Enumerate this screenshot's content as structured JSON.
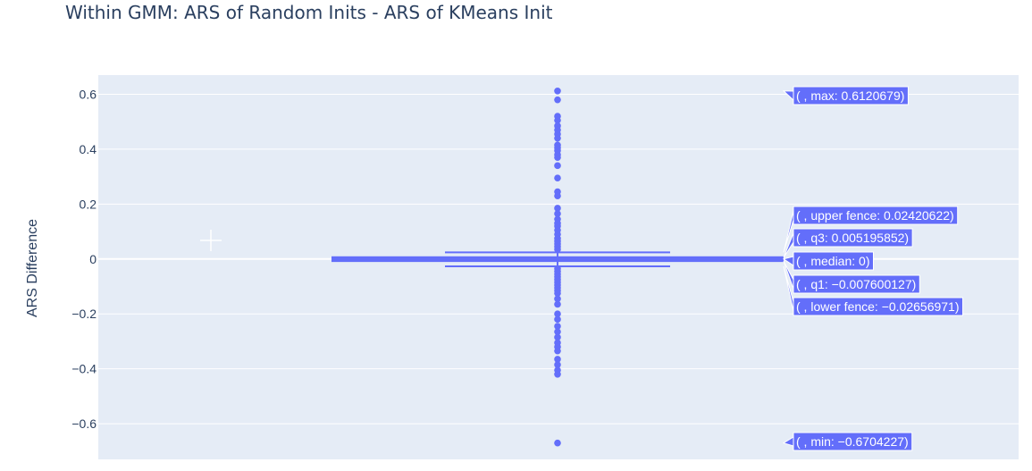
{
  "chart_data": {
    "type": "box",
    "title": "Within GMM: ARS of Random Inits - ARS of KMeans Init",
    "xlabel": "",
    "ylabel": "ARS Difference",
    "ylim": [
      -0.73,
      0.67
    ],
    "yticks": [
      {
        "value": 0.6,
        "label": "0.6"
      },
      {
        "value": 0.4,
        "label": "0.4"
      },
      {
        "value": 0.2,
        "label": "0.2"
      },
      {
        "value": 0,
        "label": "0"
      },
      {
        "value": -0.2,
        "label": "−0.2"
      },
      {
        "value": -0.4,
        "label": "−0.4"
      },
      {
        "value": -0.6,
        "label": "−0.6"
      }
    ],
    "grid": true,
    "colors": {
      "box": "#636efa",
      "background": "#e5ecf6",
      "grid": "#ffffff",
      "text": "#2a3f5f"
    },
    "stats": {
      "max": 0.6120679,
      "upper_fence": 0.02420622,
      "q3": 0.005195852,
      "median": 0,
      "q1": -0.007600127,
      "lower_fence": -0.02656971,
      "min": -0.6704227
    },
    "hover_labels": [
      {
        "key": "max",
        "text": "( , max: 0.6120679)"
      },
      {
        "key": "upper_fence",
        "text": "( , upper fence: 0.02420622)"
      },
      {
        "key": "q3",
        "text": "( , q3: 0.005195852)"
      },
      {
        "key": "median",
        "text": "( , median: 0)"
      },
      {
        "key": "q1",
        "text": "( , q1: −0.007600127)"
      },
      {
        "key": "lower_fence",
        "text": "( , lower fence: −0.02656971)"
      },
      {
        "key": "min",
        "text": "( , min: −0.6704227)"
      }
    ],
    "outliers": [
      0.6120679,
      0.58,
      0.52,
      0.505,
      0.485,
      0.47,
      0.455,
      0.44,
      0.415,
      0.405,
      0.395,
      0.38,
      0.37,
      0.34,
      0.295,
      0.245,
      0.23,
      0.185,
      0.165,
      0.145,
      0.13,
      0.12,
      0.105,
      0.09,
      0.075,
      0.065,
      0.055,
      0.045,
      0.035,
      -0.035,
      -0.045,
      -0.055,
      -0.065,
      -0.075,
      -0.085,
      -0.095,
      -0.105,
      -0.115,
      -0.125,
      -0.145,
      -0.165,
      -0.2,
      -0.22,
      -0.245,
      -0.265,
      -0.285,
      -0.305,
      -0.32,
      -0.335,
      -0.365,
      -0.385,
      -0.405,
      -0.42,
      -0.6704227
    ]
  }
}
